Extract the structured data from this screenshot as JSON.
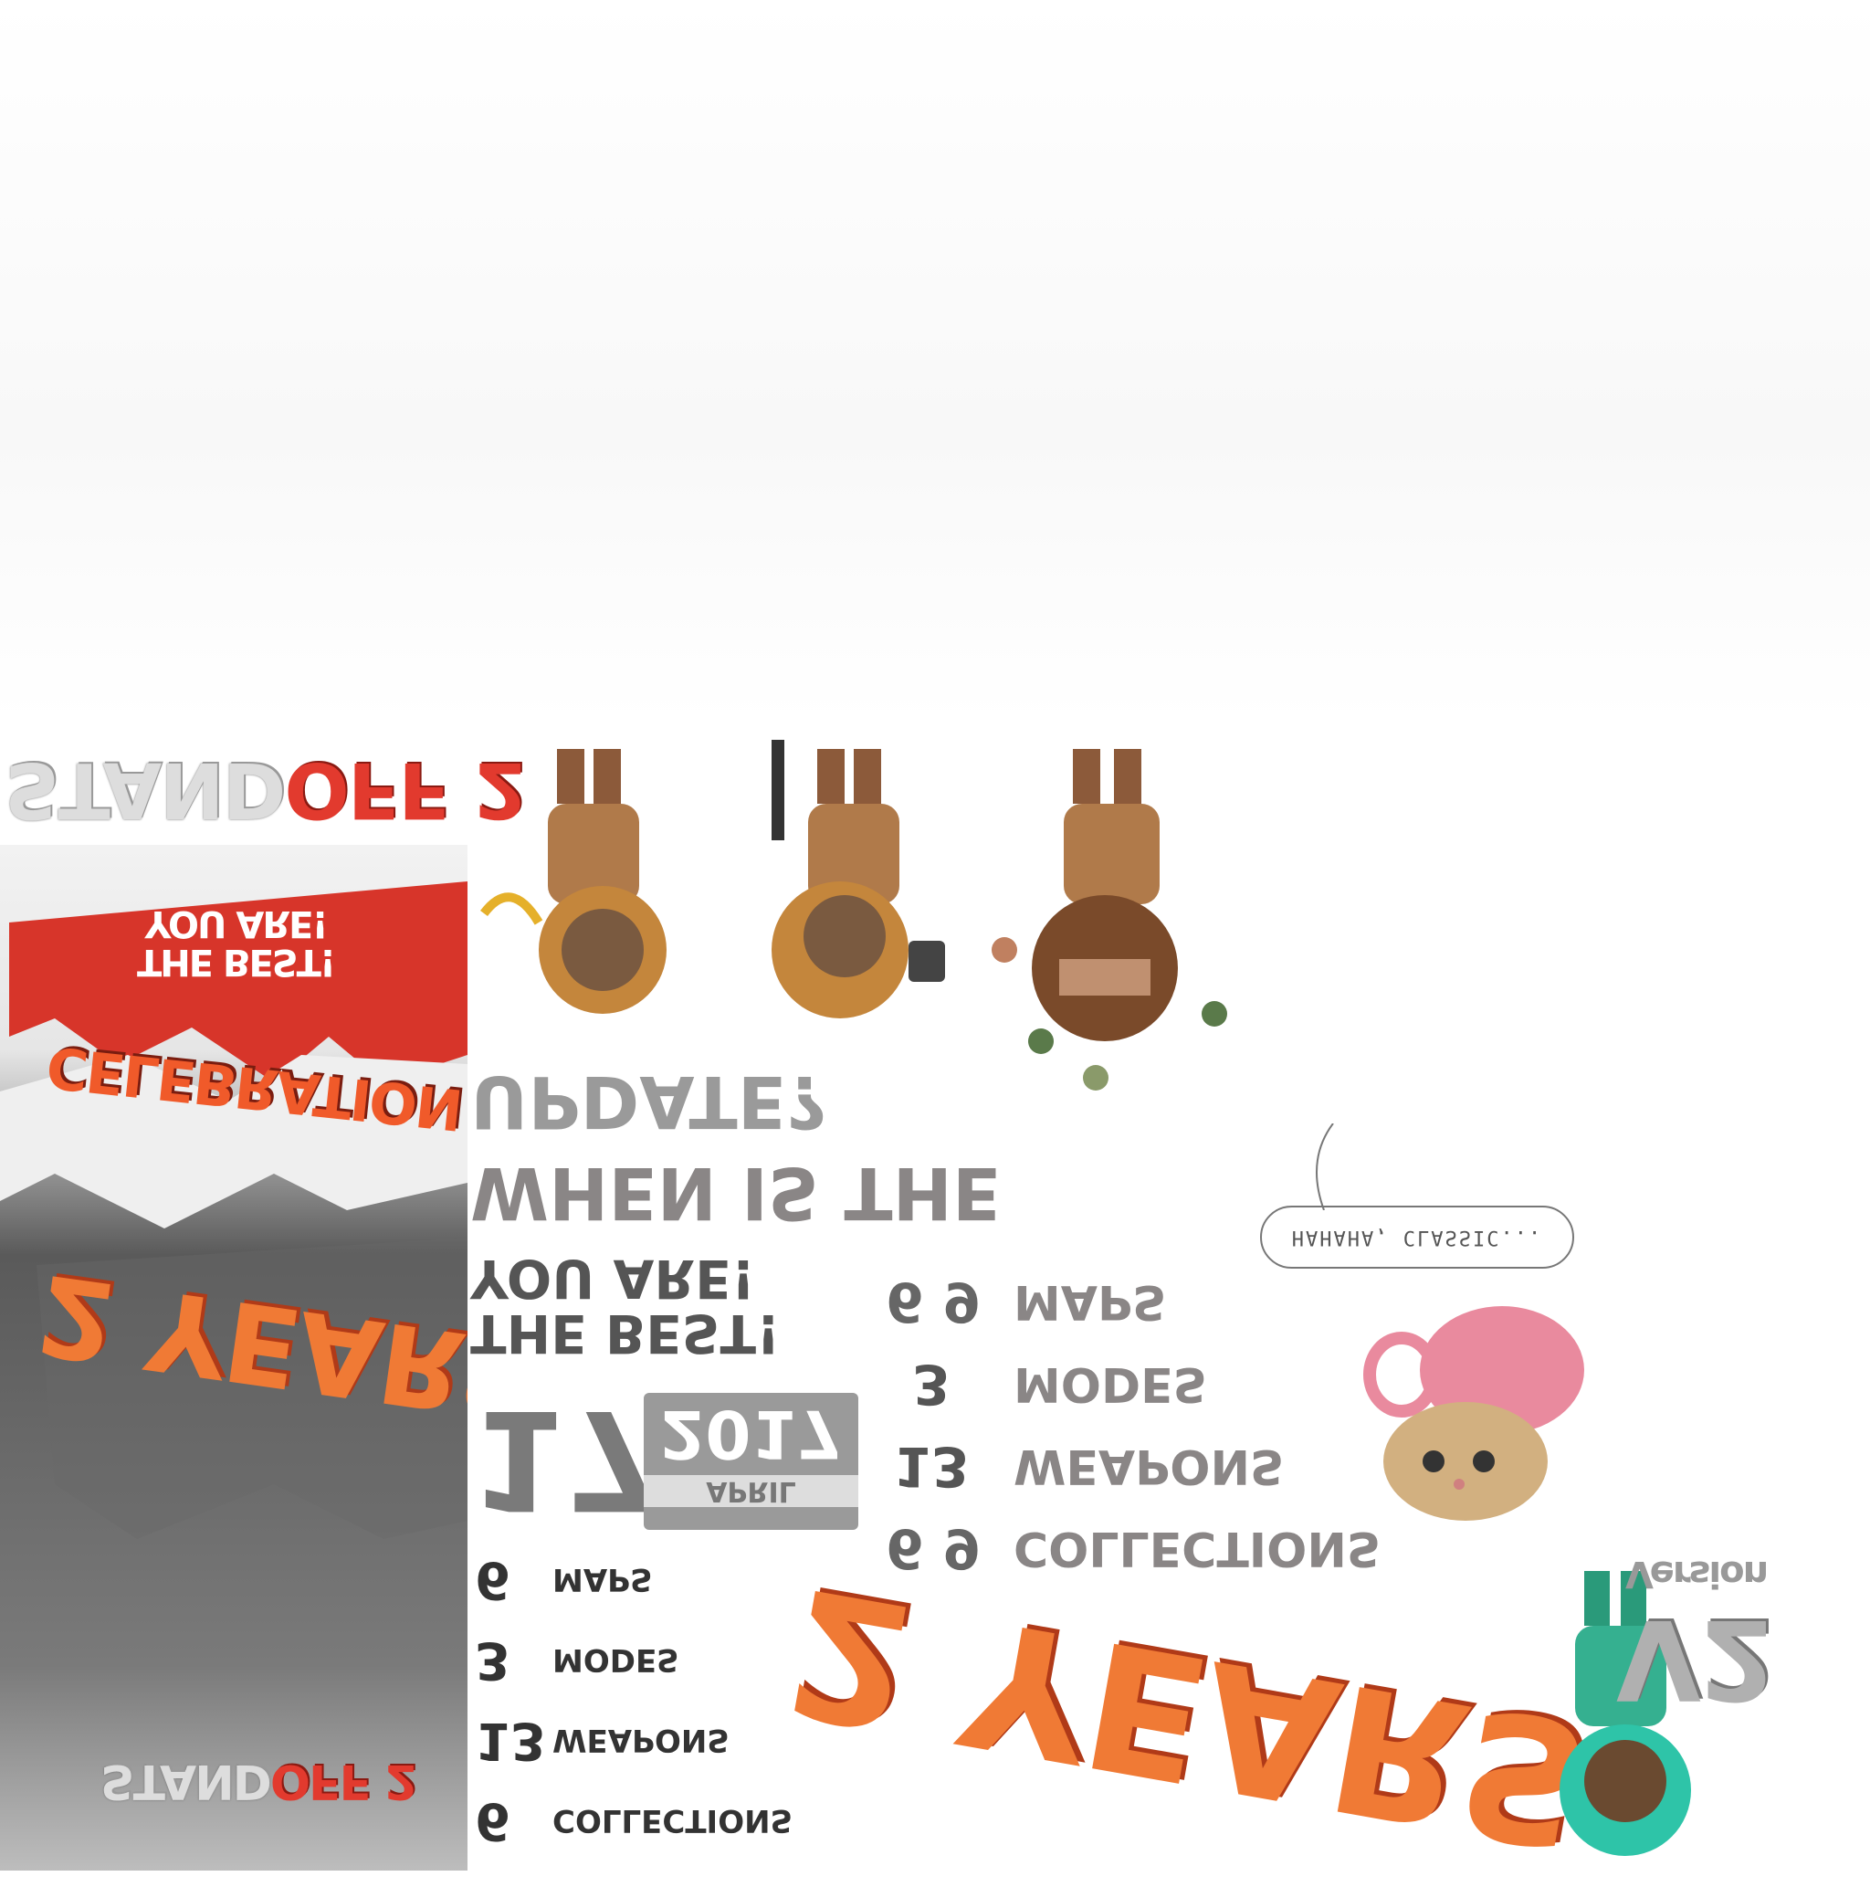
{
  "logo_top": {
    "part1": "STAND",
    "part2": "OFF 2"
  },
  "poster": {
    "banner_text_line1": "THE BEST!",
    "banner_text_line2": "YOU ARE!",
    "celebration": "CELEBRATION",
    "years": "2 YEARS",
    "logo_part1": "STAND",
    "logo_part2": "OFF 2"
  },
  "headline": {
    "line1": "UPDATE?",
    "line2": "WHEN IS THE",
    "line3": "THE BEST!",
    "line4": "YOU ARE!"
  },
  "date": {
    "day": "17",
    "year": "2017",
    "month": "APRIL"
  },
  "stats_left": [
    {
      "num": "6",
      "label": "MAPS"
    },
    {
      "num": "3",
      "label": "MODES"
    },
    {
      "num": "13",
      "label": "WEAPONS"
    },
    {
      "num": "6",
      "label": "COLLECTIONS"
    }
  ],
  "stats_right": [
    {
      "num": "6 9",
      "label": "MAPS"
    },
    {
      "num": "3",
      "label": "MODES"
    },
    {
      "num": "13",
      "label": "WEAPONS"
    },
    {
      "num": "6 9",
      "label": "COLLECTIONS"
    }
  ],
  "speech_bubble": "HAHAHA, CLASSIC...",
  "big_years": "2 YEARS",
  "version_badge": {
    "version": "Version",
    "v": "V2"
  }
}
